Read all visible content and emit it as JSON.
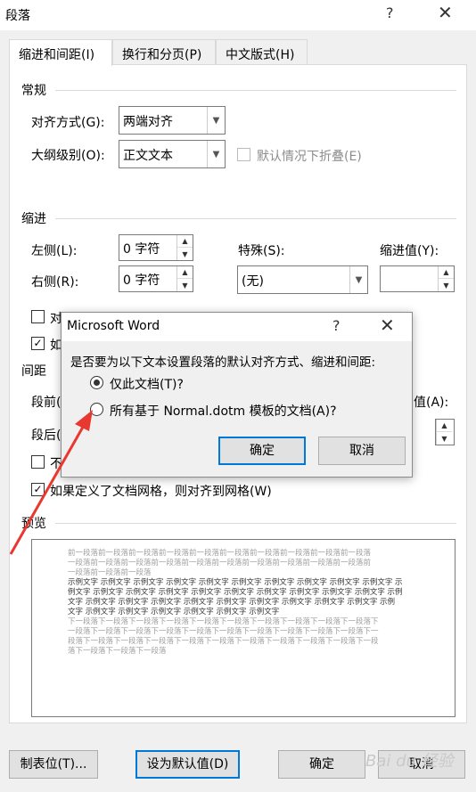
{
  "window": {
    "title": "段落",
    "help_label": "?",
    "close_label": "✕"
  },
  "tabs": [
    {
      "label": "缩进和间距(I)",
      "active": true
    },
    {
      "label": "换行和分页(P)",
      "active": false
    },
    {
      "label": "中文版式(H)",
      "active": false
    }
  ],
  "general": {
    "heading": "常规",
    "alignment_label": "对齐方式(G):",
    "alignment_value": "两端对齐",
    "outline_label": "大纲级别(O):",
    "outline_value": "正文文本",
    "collapse_label": "默认情况下折叠(E)"
  },
  "indent": {
    "heading": "缩进",
    "left_label": "左侧(L):",
    "left_value": "0 字符",
    "right_label": "右侧(R):",
    "right_value": "0 字符",
    "special_label": "特殊(S):",
    "special_value": "(无)",
    "indent_by_label": "缩进值(Y):",
    "indent_by_value": "",
    "check1_label": "对",
    "check2_label": "如"
  },
  "spacing": {
    "heading": "间距",
    "before_label": "段前(",
    "after_label": "段后(",
    "value_label": "值(A):",
    "no_space_label": "不",
    "grid_label": "如果定义了文档网格，则对齐到网格(W)"
  },
  "preview": {
    "heading": "预览",
    "prev_lines": [
      "前一段落前一段落前一段落前一段落前一段落前一段落前一段落前一段落前一段落前一段落",
      "一段落前一段落前一段落前一段落前一段落前一段落前一段落前一段落前一段落前一段落前",
      "一段落前一段落前一段落"
    ],
    "sample_lines": [
      "示例文字 示例文字 示例文字 示例文字 示例文字 示例文字 示例文字 示例文字 示例文字 示例文字 示",
      "例文字 示例文字 示例文字 示例文字 示例文字 示例文字 示例文字 示例文字 示例文字 示例文字 示例",
      "文字 示例文字 示例文字 示例文字 示例文字 示例文字 示例文字 示例文字 示例文字 示例文字 示例",
      "文字 示例文字 示例文字 示例文字 示例文字 示例文字 示例文字"
    ],
    "next_lines": [
      "下一段落下一段落下一段落下一段落下一段落下一段落下一段落下一段落下一段落下一段落下",
      "一段落下一段落下一段落下一段落下一段落下一段落下一段落下一段落下一段落下一段落下一",
      "段落下一段落下一段落下一段落下一段落下一段落下一段落下一段落下一段落下一段落下一段",
      "落下一段落下一段落下一段落"
    ]
  },
  "footer": {
    "tabs_button": "制表位(T)...",
    "default_button": "设为默认值(D)",
    "ok_button": "确定",
    "cancel_button": "取消"
  },
  "dialog": {
    "title": "Microsoft Word",
    "help_label": "?",
    "close_label": "✕",
    "prompt": "是否要为以下文本设置段落的默认对齐方式、缩进和间距:",
    "option1": "仅此文档(T)?",
    "option2": "所有基于 Normal.dotm 模板的文档(A)?",
    "selected_option": "option1",
    "ok_button": "确定",
    "cancel_button": "取消"
  },
  "watermark": "Bai du 经验",
  "annotation_color": "#e8382f"
}
